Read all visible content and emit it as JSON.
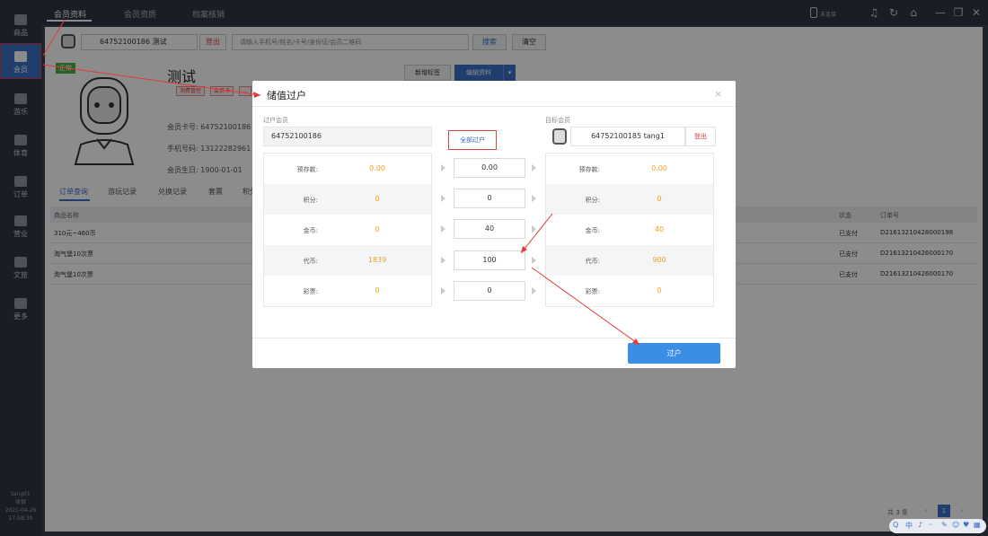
{
  "colors": {
    "accent": "#3a6fc6",
    "danger": "#d33333",
    "value_orange": "#f0a020",
    "success": "#4cae4c",
    "nav_bg": "#2e3544"
  },
  "leftnav": {
    "items": [
      {
        "label": "商品",
        "icon": "goods-icon"
      },
      {
        "label": "会员",
        "icon": "member-icon",
        "active": true
      },
      {
        "label": "游乐",
        "icon": "play-icon"
      },
      {
        "label": "体育",
        "icon": "sport-icon"
      },
      {
        "label": "订单",
        "icon": "order-icon"
      },
      {
        "label": "营业",
        "icon": "business-icon"
      },
      {
        "label": "文旅",
        "icon": "tourism-icon"
      },
      {
        "label": "更多",
        "icon": "more-icon"
      }
    ],
    "user": "tang01",
    "role": "收银",
    "date": "2021-04-26",
    "time": "17:58:30"
  },
  "topbar": {
    "tabs": [
      "会员资料",
      "会员资质",
      "档案核销"
    ],
    "status": "未连接"
  },
  "member_search": {
    "card_label": "64752100186 测试",
    "logout": "登出",
    "search_placeholder": "请输入手机号/姓名/卡号/身份证/会员二维码",
    "search_btn": "搜索",
    "clear_btn": "清空"
  },
  "member": {
    "badge": "正常",
    "name": "测试",
    "tags": [
      "消费管控",
      "会员卡",
      "..."
    ],
    "card_no": "会员卡号: 64752100186",
    "phone": "手机号码: 13122282961",
    "birthday": "会员生日: 1900-01-01",
    "btn_new_tag": "新增标签",
    "btn_edit": "编辑资料"
  },
  "subtabs": [
    "订单查询",
    "游玩记录",
    "兑换记录",
    "套票",
    "积分"
  ],
  "table": {
    "headers": {
      "name": "商品名称",
      "status": "状态",
      "order_no": "订单号"
    },
    "rows": [
      {
        "name": "310元~460币",
        "status": "已支付",
        "order_no": "D21613210428000198"
      },
      {
        "name": "淘气堡10次票",
        "status": "已支付",
        "order_no": "D21613210426000170"
      },
      {
        "name": "淘气堡10次票",
        "status": "已支付",
        "order_no": "D21613210426000170"
      }
    ]
  },
  "pager": {
    "total": "共 3 条",
    "page": "1",
    "prev": "‹",
    "next": "›"
  },
  "modal": {
    "title": "储值过户",
    "close": "×",
    "from_label": "过户会员",
    "to_label": "目标会员",
    "from_card": "64752100186",
    "transfer_all": "全部过户",
    "to_card": "64752100185  tang1",
    "to_logout": "登出",
    "rows": [
      {
        "label": "预存款:",
        "from": "0.00",
        "amount": "0.00",
        "to": "0.00"
      },
      {
        "label": "积分:",
        "from": "0",
        "amount": "0",
        "to": "0"
      },
      {
        "label": "金币:",
        "from": "0",
        "amount": "40",
        "to": "40"
      },
      {
        "label": "代币:",
        "from": "1839",
        "amount": "100",
        "to": "900"
      },
      {
        "label": "彩票:",
        "from": "0",
        "amount": "0",
        "to": "0"
      }
    ],
    "submit": "过户"
  },
  "tray": [
    "Q",
    "中",
    "♪",
    "··",
    "✎",
    "☺",
    "♥",
    "▦"
  ]
}
